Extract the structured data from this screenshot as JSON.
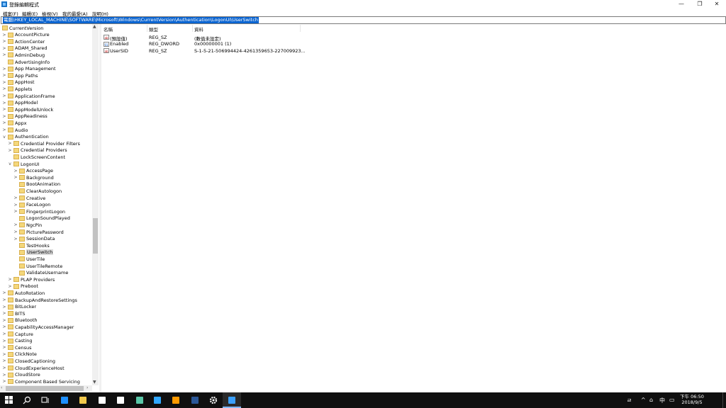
{
  "window": {
    "title": "登錄編輯程式",
    "controls": {
      "minimize": "—",
      "maximize": "❐",
      "close": "✕"
    }
  },
  "menu": [
    "檔案(F)",
    "編輯(E)",
    "檢視(V)",
    "我的最愛(A)",
    "說明(H)"
  ],
  "address": {
    "prefix": "電腦\\",
    "path": "HKEY_LOCAL_MACHINE\\SOFTWARE\\Microsoft\\Windows\\CurrentVersion\\Authentication\\LogonUI\\UserSwitch"
  },
  "tree": [
    {
      "label": "CurrentVersion",
      "level": 0,
      "exp": "",
      "sel": false
    },
    {
      "label": "AccountPicture",
      "level": 1,
      "exp": ">",
      "sel": false
    },
    {
      "label": "ActionCenter",
      "level": 1,
      "exp": ">",
      "sel": false
    },
    {
      "label": "ADAM_Shared",
      "level": 1,
      "exp": ">",
      "sel": false
    },
    {
      "label": "AdminDebug",
      "level": 1,
      "exp": ">",
      "sel": false
    },
    {
      "label": "AdvertisingInfo",
      "level": 1,
      "exp": "",
      "sel": false
    },
    {
      "label": "App Management",
      "level": 1,
      "exp": ">",
      "sel": false
    },
    {
      "label": "App Paths",
      "level": 1,
      "exp": ">",
      "sel": false
    },
    {
      "label": "AppHost",
      "level": 1,
      "exp": ">",
      "sel": false
    },
    {
      "label": "Applets",
      "level": 1,
      "exp": ">",
      "sel": false
    },
    {
      "label": "ApplicationFrame",
      "level": 1,
      "exp": ">",
      "sel": false
    },
    {
      "label": "AppModel",
      "level": 1,
      "exp": ">",
      "sel": false
    },
    {
      "label": "AppModelUnlock",
      "level": 1,
      "exp": ">",
      "sel": false
    },
    {
      "label": "AppReadiness",
      "level": 1,
      "exp": ">",
      "sel": false
    },
    {
      "label": "Appx",
      "level": 1,
      "exp": ">",
      "sel": false
    },
    {
      "label": "Audio",
      "level": 1,
      "exp": ">",
      "sel": false
    },
    {
      "label": "Authentication",
      "level": 1,
      "exp": "v",
      "sel": false
    },
    {
      "label": "Credential Provider Filters",
      "level": 2,
      "exp": ">",
      "sel": false
    },
    {
      "label": "Credential Providers",
      "level": 2,
      "exp": ">",
      "sel": false
    },
    {
      "label": "LockScreenContent",
      "level": 2,
      "exp": "",
      "sel": false
    },
    {
      "label": "LogonUI",
      "level": 2,
      "exp": "v",
      "sel": false
    },
    {
      "label": "AccessPage",
      "level": 3,
      "exp": ">",
      "sel": false
    },
    {
      "label": "Background",
      "level": 3,
      "exp": ">",
      "sel": false
    },
    {
      "label": "BootAnimation",
      "level": 3,
      "exp": "",
      "sel": false
    },
    {
      "label": "ClearAutologon",
      "level": 3,
      "exp": "",
      "sel": false
    },
    {
      "label": "Creative",
      "level": 3,
      "exp": ">",
      "sel": false
    },
    {
      "label": "FaceLogon",
      "level": 3,
      "exp": ">",
      "sel": false
    },
    {
      "label": "FingerprintLogon",
      "level": 3,
      "exp": ">",
      "sel": false
    },
    {
      "label": "LogonSoundPlayed",
      "level": 3,
      "exp": "",
      "sel": false
    },
    {
      "label": "NgcPin",
      "level": 3,
      "exp": ">",
      "sel": false
    },
    {
      "label": "PicturePassword",
      "level": 3,
      "exp": ">",
      "sel": false
    },
    {
      "label": "SessionData",
      "level": 3,
      "exp": ">",
      "sel": false
    },
    {
      "label": "TestHooks",
      "level": 3,
      "exp": "",
      "sel": false
    },
    {
      "label": "UserSwitch",
      "level": 3,
      "exp": "",
      "sel": true
    },
    {
      "label": "UserTile",
      "level": 3,
      "exp": "",
      "sel": false
    },
    {
      "label": "UserTileRemote",
      "level": 3,
      "exp": "",
      "sel": false
    },
    {
      "label": "ValidateUsername",
      "level": 3,
      "exp": "",
      "sel": false
    },
    {
      "label": "PLAP Providers",
      "level": 2,
      "exp": ">",
      "sel": false
    },
    {
      "label": "Preboot",
      "level": 2,
      "exp": ">",
      "sel": false
    },
    {
      "label": "AutoRotation",
      "level": 1,
      "exp": ">",
      "sel": false
    },
    {
      "label": "BackupAndRestoreSettings",
      "level": 1,
      "exp": ">",
      "sel": false
    },
    {
      "label": "BitLocker",
      "level": 1,
      "exp": ">",
      "sel": false
    },
    {
      "label": "BITS",
      "level": 1,
      "exp": ">",
      "sel": false
    },
    {
      "label": "Bluetooth",
      "level": 1,
      "exp": ">",
      "sel": false
    },
    {
      "label": "CapabilityAccessManager",
      "level": 1,
      "exp": ">",
      "sel": false
    },
    {
      "label": "Capture",
      "level": 1,
      "exp": ">",
      "sel": false
    },
    {
      "label": "Casting",
      "level": 1,
      "exp": ">",
      "sel": false
    },
    {
      "label": "Census",
      "level": 1,
      "exp": ">",
      "sel": false
    },
    {
      "label": "ClickNote",
      "level": 1,
      "exp": ">",
      "sel": false
    },
    {
      "label": "ClosedCaptioning",
      "level": 1,
      "exp": ">",
      "sel": false
    },
    {
      "label": "CloudExperienceHost",
      "level": 1,
      "exp": ">",
      "sel": false
    },
    {
      "label": "CloudStore",
      "level": 1,
      "exp": ">",
      "sel": false
    },
    {
      "label": "Component Based Servicing",
      "level": 1,
      "exp": ">",
      "sel": false
    }
  ],
  "columns": {
    "name": "名稱",
    "type": "類型",
    "data": "資料"
  },
  "values": [
    {
      "icon": "ab",
      "name": "(預設值)",
      "type": "REG_SZ",
      "data": "(數值未設定)"
    },
    {
      "icon": "01",
      "name": "Enabled",
      "type": "REG_DWORD",
      "data": "0x00000001 (1)"
    },
    {
      "icon": "ab",
      "name": "UserSID",
      "type": "REG_SZ",
      "data": "S-1-5-21-506994424-4261359653-227009923..."
    }
  ],
  "taskbar": {
    "apps": [
      {
        "name": "start-icon",
        "color": "#ffffff"
      },
      {
        "name": "search-icon",
        "color": "#ffffff"
      },
      {
        "name": "task-view-icon",
        "color": "#ffffff"
      },
      {
        "name": "edge-icon",
        "color": "#1e90ff"
      },
      {
        "name": "file-explorer-icon",
        "color": "#f2c94c"
      },
      {
        "name": "mail-icon",
        "color": "#ffffff"
      },
      {
        "name": "store-icon",
        "color": "#ffffff"
      },
      {
        "name": "notes-icon",
        "color": "#5ac8a8"
      },
      {
        "name": "photoshop-icon",
        "color": "#31a8ff"
      },
      {
        "name": "illustrator-icon",
        "color": "#ff9a00"
      },
      {
        "name": "word-icon",
        "color": "#2b5797"
      },
      {
        "name": "settings-icon",
        "color": "#ffffff"
      },
      {
        "name": "regedit-icon",
        "color": "#3aa0ff"
      }
    ],
    "tray": [
      "ㄹ",
      "^",
      "⌂",
      "中",
      "▭"
    ],
    "time": "下午 06:50",
    "date": "2018/9/5"
  }
}
